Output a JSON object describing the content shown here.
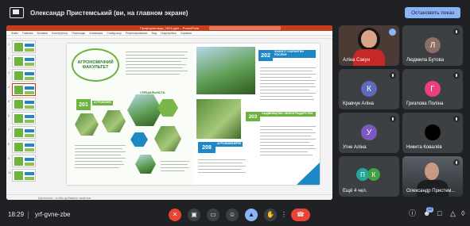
{
  "topbar": {
    "title": "Олександр Пристемський (ви, на главном экране)",
    "stop_label": "Остановить показ"
  },
  "ppt": {
    "title": "Профорієнтація_2024.pptx – PowerPoint",
    "menu": [
      "Файл",
      "Главная",
      "Вставка",
      "Конструктор",
      "Переходы",
      "Анимация",
      "Слайд-шоу",
      "Рецензирование",
      "Вид",
      "Надстройки",
      "Справка"
    ],
    "status": "Щелкните, чтобы добавить заметки",
    "slide_numbers": [
      "1",
      "2",
      "3",
      "4",
      "5",
      "6",
      "7",
      "8",
      "9",
      "10"
    ]
  },
  "slide": {
    "faculty_title": "АГРОНОМІЧНИЙ ФАКУЛЬТЕТ",
    "spec_label": "СПЕЦІАЛЬНІСТЬ",
    "codes": [
      {
        "code": "201",
        "label": "АГРОНОМІЯ"
      },
      {
        "code": "202",
        "label": "ЗАХИСТ І КАРАНТИН РОСЛИН"
      },
      {
        "code": "203",
        "label": "САДІВНИЦТВО І ВИНОГРАДАРСТВО"
      },
      {
        "code": "208",
        "label": "АГРОІНЖЕНЕРІЯ"
      }
    ]
  },
  "participants": [
    {
      "name": "Аліна Сакун",
      "initial": "",
      "color": "#4a3b35",
      "speaking": true
    },
    {
      "name": "Людмила Бутова",
      "initial": "Л",
      "color": "#8d6e63",
      "muted": true
    },
    {
      "name": "Кравчук Аліна",
      "initial": "К",
      "color": "#5c6bc0",
      "muted": true
    },
    {
      "name": "Гризлова Поліна",
      "initial": "Г",
      "color": "#ec407a",
      "muted": true
    },
    {
      "name": "Угне Аліна",
      "initial": "У",
      "color": "#7e57c2",
      "muted": true
    },
    {
      "name": "Никита Ковалёв",
      "initial": "",
      "color": "#000000",
      "muted": true
    },
    {
      "name": "Ещё 4 чел.",
      "initial": "П",
      "initial2": "К",
      "color": "#26a69a",
      "color2": "#43a047"
    },
    {
      "name": "Олександр Пристем...",
      "initial": "",
      "color": "#2e3236",
      "muted": true
    }
  ],
  "bottombar": {
    "time": "18:29",
    "meeting_code": "yrf-gvne-zbe",
    "participants_count": "12"
  },
  "icons": {
    "present": "present-icon",
    "mic_off": "mic-off-icon",
    "camera": "camera-icon",
    "captions": "captions-icon",
    "emoji": "emoji-icon",
    "present_now": "present-now-icon",
    "hand": "raise-hand-icon",
    "more": "more-options-icon",
    "hangup": "hang-up-icon",
    "info": "info-icon",
    "people": "people-icon",
    "chat": "chat-icon",
    "activities": "activities-icon",
    "lock": "host-controls-icon"
  }
}
